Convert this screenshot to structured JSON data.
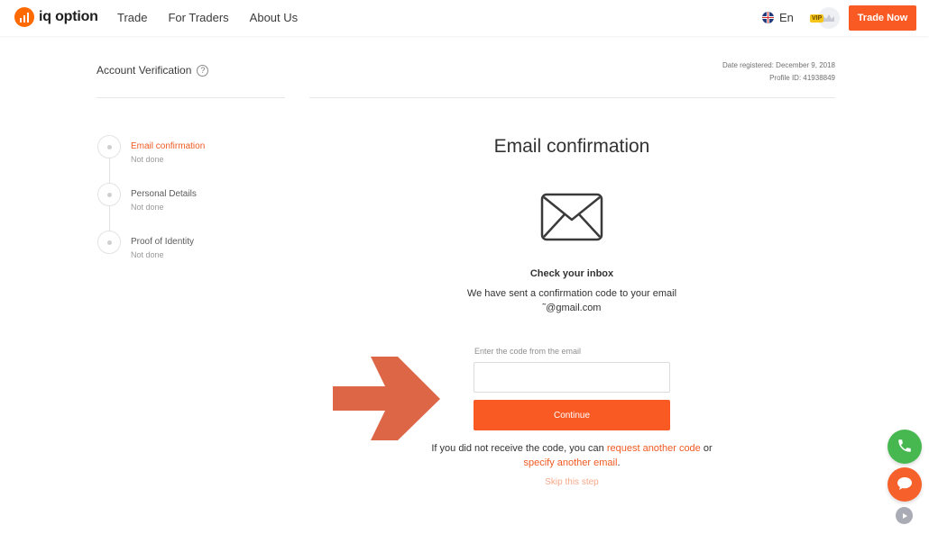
{
  "header": {
    "logo_text": "iq option",
    "nav": [
      "Trade",
      "For Traders",
      "About Us"
    ],
    "lang": "En",
    "vip_badge": "VIP",
    "trade_now": "Trade Now"
  },
  "account": {
    "title": "Account Verification",
    "help": "?",
    "date_registered": "Date registered: December 9, 2018",
    "profile_id": "Profile ID: 41938849"
  },
  "steps": [
    {
      "title": "Email confirmation",
      "status": "Not done",
      "active": true
    },
    {
      "title": "Personal Details",
      "status": "Not done",
      "active": false
    },
    {
      "title": "Proof of Identity",
      "status": "Not done",
      "active": false
    }
  ],
  "main": {
    "title": "Email confirmation",
    "check_title": "Check your inbox",
    "sent_text": "We have sent a confirmation code to your email",
    "email": "˜@gmail.com",
    "code_label": "Enter the code from the email",
    "code_value": "",
    "continue": "Continue",
    "resend_prefix": "If you did not receive the code, you can ",
    "resend_link": "request another code",
    "resend_middle": " or",
    "other_email_link": "specify another email",
    "resend_suffix": ".",
    "skip": "Skip this step"
  },
  "colors": {
    "accent": "#f95a23",
    "arrow": "#dd6647",
    "phone": "#47b84f",
    "chat": "#f6612b"
  },
  "icons": {
    "envelope": "envelope-icon",
    "arrow": "arrow-right-icon",
    "phone": "phone-icon",
    "chat": "chat-icon",
    "play": "play-icon",
    "crown": "crown-icon",
    "flag": "uk-flag-icon"
  }
}
